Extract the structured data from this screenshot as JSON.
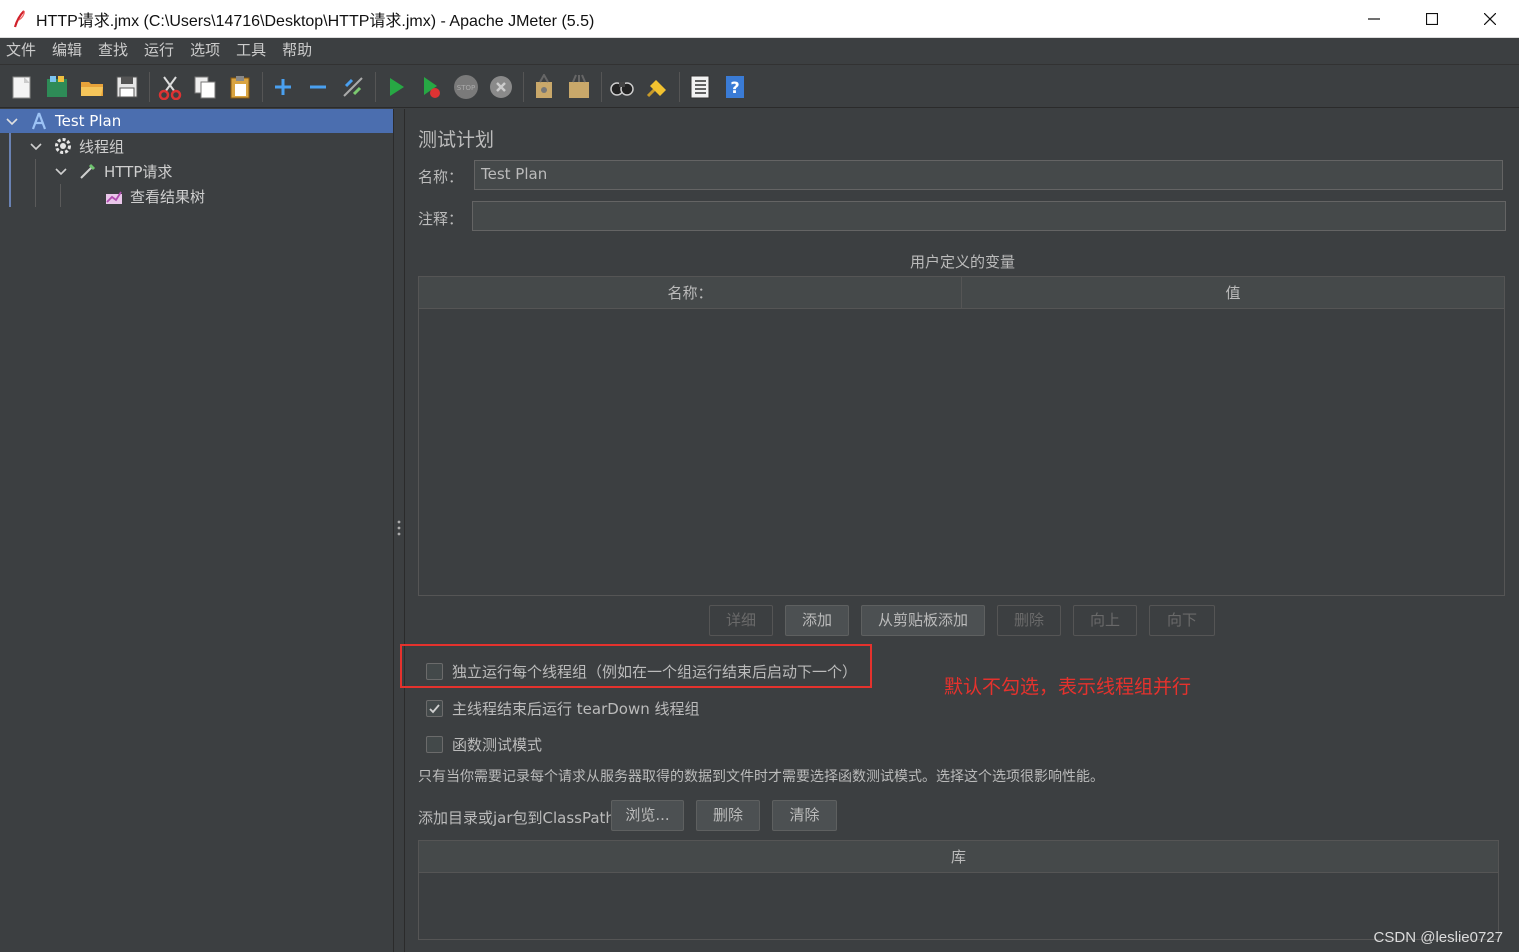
{
  "window": {
    "title": "HTTP请求.jmx (C:\\Users\\14716\\Desktop\\HTTP请求.jmx) - Apache JMeter (5.5)"
  },
  "menu": [
    "文件",
    "编辑",
    "查找",
    "运行",
    "选项",
    "工具",
    "帮助"
  ],
  "toolbar_icons": [
    "new-icon",
    "templates-icon",
    "open-icon",
    "save-icon",
    "cut-icon",
    "copy-icon",
    "paste-icon",
    "expand-icon",
    "collapse-icon",
    "toggle-icon",
    "start-icon",
    "start-no-pause-icon",
    "stop-icon",
    "shutdown-icon",
    "clear-icon",
    "clear-all-icon",
    "search-icon",
    "reset-search-icon",
    "function-helper-icon",
    "help-icon"
  ],
  "tree": {
    "test_plan": "Test Plan",
    "thread_group": "线程组",
    "http_request": "HTTP请求",
    "view_results_tree": "查看结果树"
  },
  "main": {
    "section_title": "测试计划",
    "name_label": "名称：",
    "name_value": "Test Plan",
    "comment_label": "注释：",
    "comment_value": "",
    "variables_title": "用户定义的变量",
    "variables_columns": [
      "名称：",
      "值"
    ],
    "buttons": {
      "detail": "详细",
      "add": "添加",
      "add_from_clipboard": "从剪贴板添加",
      "delete": "删除",
      "up": "向上",
      "down": "向下"
    },
    "options": {
      "serialize_label": "独立运行每个线程组（例如在一个组运行结束后启动下一个）",
      "serialize_checked": false,
      "teardown_label": "主线程结束后运行 tearDown 线程组",
      "teardown_checked": true,
      "functional_label": "函数测试模式",
      "functional_checked": false
    },
    "functional_note": "只有当你需要记录每个请求从服务器取得的数据到文件时才需要选择函数测试模式。选择这个选项很影响性能。",
    "classpath_label": "添加目录或jar包到ClassPath",
    "classpath_buttons": {
      "browse": "浏览...",
      "delete": "删除",
      "clear": "清除"
    },
    "library_column": "库"
  },
  "annotation": "默认不勾选，表示线程组并行",
  "watermark": "CSDN @leslie0727"
}
